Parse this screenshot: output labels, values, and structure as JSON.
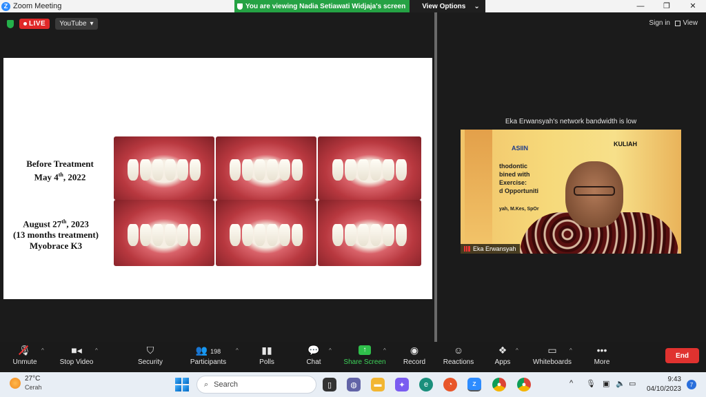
{
  "window": {
    "title": "Zoom Meeting",
    "viewing_banner": "You are viewing Nadia Setiawati Widjaja's screen",
    "view_options": "View Options",
    "controls": [
      "—",
      "❐",
      "✕"
    ]
  },
  "share": {
    "live_label": "LIVE",
    "stream_target": "YouTube"
  },
  "slide": {
    "before_line1": "Before Treatment",
    "before_line2_pre": "May 4",
    "before_sup": "th",
    "before_line2_post": ", 2022",
    "after_line1_pre": "August  27",
    "after_sup": "th",
    "after_line1_post": ", 2023",
    "after_line2": "(13 months treatment)",
    "after_line3": "Myobrace K3"
  },
  "right_panel": {
    "sign_in": "Sign in",
    "view": "View",
    "network_message": "Eka Erwansyah's network bandwidth is low",
    "participant_name": "Eka Erwansyah",
    "video_text": {
      "brand": "ASIIN",
      "kuliah": "KULIAH",
      "line1": "thodontic",
      "line2": "bined with",
      "line3": "Exercise:",
      "line4": "d Opportuniti",
      "line5": "yah, M.Kes, SpOr"
    }
  },
  "toolbar": {
    "unmute": "Unmute",
    "stop_video": "Stop Video",
    "security": "Security",
    "participants": "Participants",
    "participants_count": "198",
    "polls": "Polls",
    "chat": "Chat",
    "share_screen": "Share Screen",
    "record": "Record",
    "reactions": "Reactions",
    "apps": "Apps",
    "whiteboards": "Whiteboards",
    "more": "More",
    "end": "End"
  },
  "taskbar": {
    "temperature": "27°C",
    "condition": "Cerah",
    "search_placeholder": "Search",
    "time": "9:43",
    "date": "04/10/2023",
    "notifications": "7"
  },
  "colors": {
    "live_red": "#e02828",
    "viewing_green": "#25a244",
    "share_green": "#3ed45a",
    "end_red": "#e0322f"
  }
}
